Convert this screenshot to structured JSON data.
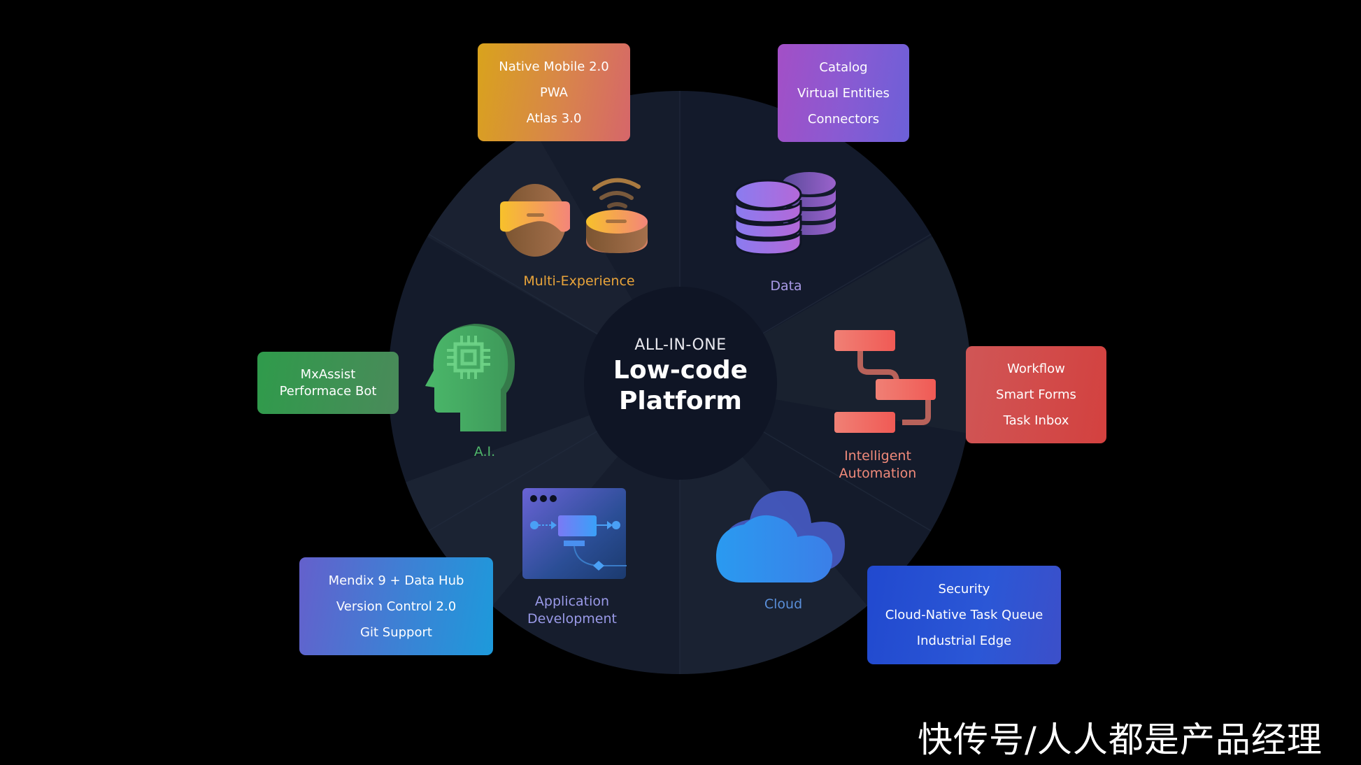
{
  "hub": {
    "subtitle": "ALL-IN-ONE",
    "title_line1": "Low-code",
    "title_line2": "Platform"
  },
  "segments": [
    {
      "id": "multi-experience",
      "label": "Multi-Experience",
      "color": "#e9a43a",
      "items": [
        "Native Mobile 2.0",
        "PWA",
        "Atlas 3.0"
      ]
    },
    {
      "id": "data",
      "label": "Data",
      "color": "#a99ae6",
      "items": [
        "Catalog",
        "Virtual Entities",
        "Connectors"
      ]
    },
    {
      "id": "intelligent-automation",
      "label_line1": "Intelligent",
      "label_line2": "Automation",
      "color": "#f08a7a",
      "items": [
        "Workflow",
        "Smart Forms",
        "Task Inbox"
      ]
    },
    {
      "id": "cloud",
      "label": "Cloud",
      "color": "#5a8fd9",
      "items": [
        "Security",
        "Cloud-Native Task Queue",
        "Industrial Edge"
      ]
    },
    {
      "id": "application-development",
      "label_line1": "Application",
      "label_line2": "Development",
      "color": "#9a9ae8",
      "items": [
        "Mendix 9 + Data Hub",
        "Version Control 2.0",
        "Git Support"
      ]
    },
    {
      "id": "ai",
      "label": "A.I.",
      "color": "#4fb56a",
      "items": [
        "MxAssist",
        "Performace Bot"
      ]
    }
  ],
  "watermark": "快传号/人人都是产品经理"
}
